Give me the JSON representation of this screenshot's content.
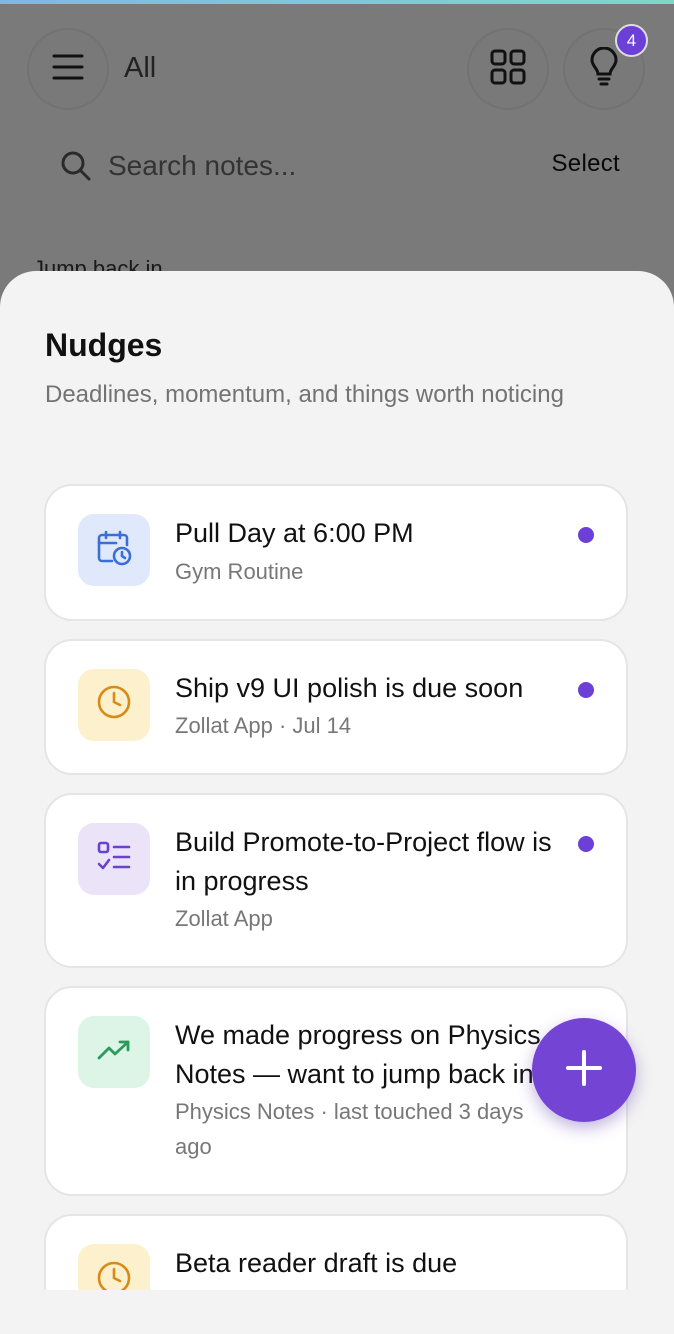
{
  "header": {
    "view_label": "All",
    "notification_count": "4"
  },
  "search": {
    "placeholder": "Search notes...",
    "select_label": "Select"
  },
  "background": {
    "section_label": "Jump back in"
  },
  "sheet": {
    "title": "Nudges",
    "subtitle": "Deadlines, momentum, and things worth noticing",
    "items": [
      {
        "title": "Pull Day at 6:00 PM",
        "meta": "Gym Routine",
        "icon": "calendar-clock-icon",
        "icon_bg": "#dfe9fb",
        "icon_color": "#3b6fd8",
        "unread": true
      },
      {
        "title": "Ship v9 UI polish is due soon",
        "meta": "Zollat App · Jul 14",
        "icon": "clock-icon",
        "icon_bg": "#fcf1cc",
        "icon_color": "#d98a16",
        "unread": true
      },
      {
        "title": "Build Promote-to-Project flow is in progress",
        "meta": "Zollat App",
        "icon": "checklist-icon",
        "icon_bg": "#ebe3f8",
        "icon_color": "#6a42d0",
        "unread": true
      },
      {
        "title": "We made progress on Physics Notes — want to jump back in?",
        "meta": "Physics Notes · last touched 3 days ago",
        "icon": "trending-up-icon",
        "icon_bg": "#dcf5e6",
        "icon_color": "#2e9a5a",
        "unread": true
      },
      {
        "title": "Beta reader draft is due",
        "meta": "",
        "icon": "clock-icon",
        "icon_bg": "#fcf1cc",
        "icon_color": "#d98a16",
        "unread": false
      }
    ]
  },
  "colors": {
    "accent": "#7444d4",
    "unread_dot": "#6c3fd6"
  }
}
